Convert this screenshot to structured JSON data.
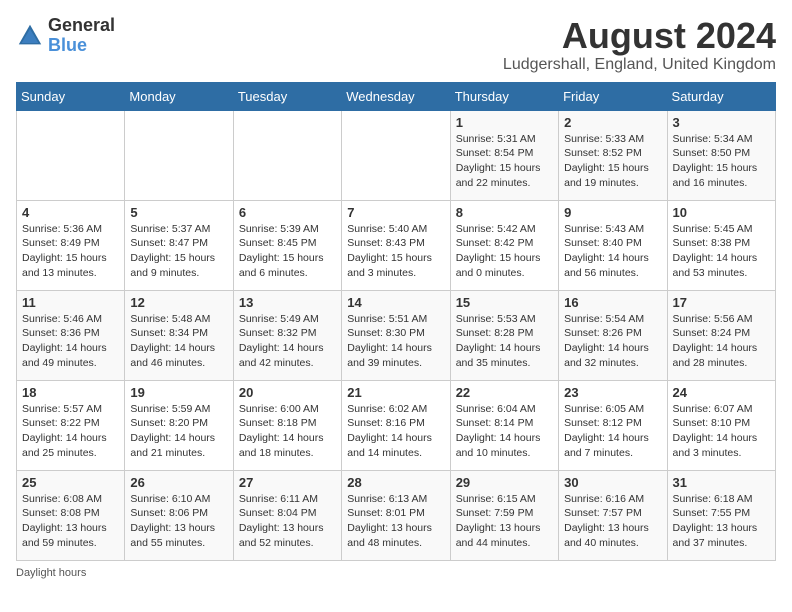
{
  "logo": {
    "text_general": "General",
    "text_blue": "Blue"
  },
  "calendar": {
    "title": "August 2024",
    "subtitle": "Ludgershall, England, United Kingdom"
  },
  "days_of_week": [
    "Sunday",
    "Monday",
    "Tuesday",
    "Wednesday",
    "Thursday",
    "Friday",
    "Saturday"
  ],
  "footer": {
    "daylight_label": "Daylight hours"
  },
  "weeks": [
    [
      {
        "day": "",
        "info": ""
      },
      {
        "day": "",
        "info": ""
      },
      {
        "day": "",
        "info": ""
      },
      {
        "day": "",
        "info": ""
      },
      {
        "day": "1",
        "info": "Sunrise: 5:31 AM\nSunset: 8:54 PM\nDaylight: 15 hours\nand 22 minutes."
      },
      {
        "day": "2",
        "info": "Sunrise: 5:33 AM\nSunset: 8:52 PM\nDaylight: 15 hours\nand 19 minutes."
      },
      {
        "day": "3",
        "info": "Sunrise: 5:34 AM\nSunset: 8:50 PM\nDaylight: 15 hours\nand 16 minutes."
      }
    ],
    [
      {
        "day": "4",
        "info": "Sunrise: 5:36 AM\nSunset: 8:49 PM\nDaylight: 15 hours\nand 13 minutes."
      },
      {
        "day": "5",
        "info": "Sunrise: 5:37 AM\nSunset: 8:47 PM\nDaylight: 15 hours\nand 9 minutes."
      },
      {
        "day": "6",
        "info": "Sunrise: 5:39 AM\nSunset: 8:45 PM\nDaylight: 15 hours\nand 6 minutes."
      },
      {
        "day": "7",
        "info": "Sunrise: 5:40 AM\nSunset: 8:43 PM\nDaylight: 15 hours\nand 3 minutes."
      },
      {
        "day": "8",
        "info": "Sunrise: 5:42 AM\nSunset: 8:42 PM\nDaylight: 15 hours\nand 0 minutes."
      },
      {
        "day": "9",
        "info": "Sunrise: 5:43 AM\nSunset: 8:40 PM\nDaylight: 14 hours\nand 56 minutes."
      },
      {
        "day": "10",
        "info": "Sunrise: 5:45 AM\nSunset: 8:38 PM\nDaylight: 14 hours\nand 53 minutes."
      }
    ],
    [
      {
        "day": "11",
        "info": "Sunrise: 5:46 AM\nSunset: 8:36 PM\nDaylight: 14 hours\nand 49 minutes."
      },
      {
        "day": "12",
        "info": "Sunrise: 5:48 AM\nSunset: 8:34 PM\nDaylight: 14 hours\nand 46 minutes."
      },
      {
        "day": "13",
        "info": "Sunrise: 5:49 AM\nSunset: 8:32 PM\nDaylight: 14 hours\nand 42 minutes."
      },
      {
        "day": "14",
        "info": "Sunrise: 5:51 AM\nSunset: 8:30 PM\nDaylight: 14 hours\nand 39 minutes."
      },
      {
        "day": "15",
        "info": "Sunrise: 5:53 AM\nSunset: 8:28 PM\nDaylight: 14 hours\nand 35 minutes."
      },
      {
        "day": "16",
        "info": "Sunrise: 5:54 AM\nSunset: 8:26 PM\nDaylight: 14 hours\nand 32 minutes."
      },
      {
        "day": "17",
        "info": "Sunrise: 5:56 AM\nSunset: 8:24 PM\nDaylight: 14 hours\nand 28 minutes."
      }
    ],
    [
      {
        "day": "18",
        "info": "Sunrise: 5:57 AM\nSunset: 8:22 PM\nDaylight: 14 hours\nand 25 minutes."
      },
      {
        "day": "19",
        "info": "Sunrise: 5:59 AM\nSunset: 8:20 PM\nDaylight: 14 hours\nand 21 minutes."
      },
      {
        "day": "20",
        "info": "Sunrise: 6:00 AM\nSunset: 8:18 PM\nDaylight: 14 hours\nand 18 minutes."
      },
      {
        "day": "21",
        "info": "Sunrise: 6:02 AM\nSunset: 8:16 PM\nDaylight: 14 hours\nand 14 minutes."
      },
      {
        "day": "22",
        "info": "Sunrise: 6:04 AM\nSunset: 8:14 PM\nDaylight: 14 hours\nand 10 minutes."
      },
      {
        "day": "23",
        "info": "Sunrise: 6:05 AM\nSunset: 8:12 PM\nDaylight: 14 hours\nand 7 minutes."
      },
      {
        "day": "24",
        "info": "Sunrise: 6:07 AM\nSunset: 8:10 PM\nDaylight: 14 hours\nand 3 minutes."
      }
    ],
    [
      {
        "day": "25",
        "info": "Sunrise: 6:08 AM\nSunset: 8:08 PM\nDaylight: 13 hours\nand 59 minutes."
      },
      {
        "day": "26",
        "info": "Sunrise: 6:10 AM\nSunset: 8:06 PM\nDaylight: 13 hours\nand 55 minutes."
      },
      {
        "day": "27",
        "info": "Sunrise: 6:11 AM\nSunset: 8:04 PM\nDaylight: 13 hours\nand 52 minutes."
      },
      {
        "day": "28",
        "info": "Sunrise: 6:13 AM\nSunset: 8:01 PM\nDaylight: 13 hours\nand 48 minutes."
      },
      {
        "day": "29",
        "info": "Sunrise: 6:15 AM\nSunset: 7:59 PM\nDaylight: 13 hours\nand 44 minutes."
      },
      {
        "day": "30",
        "info": "Sunrise: 6:16 AM\nSunset: 7:57 PM\nDaylight: 13 hours\nand 40 minutes."
      },
      {
        "day": "31",
        "info": "Sunrise: 6:18 AM\nSunset: 7:55 PM\nDaylight: 13 hours\nand 37 minutes."
      }
    ]
  ]
}
